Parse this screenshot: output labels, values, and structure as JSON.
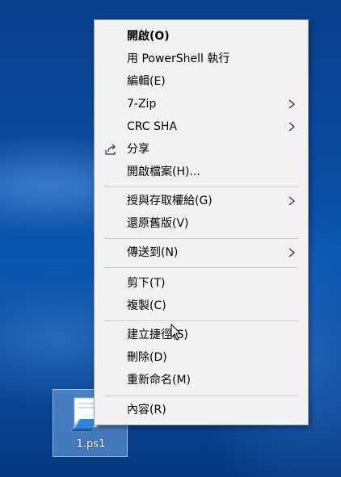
{
  "desktop": {
    "file_icon": {
      "name": "1.ps1",
      "icon": "powershell-script-file-icon"
    }
  },
  "context_menu": {
    "items": [
      {
        "label": "開啟(O)",
        "bold": true
      },
      {
        "label": "用 PowerShell 執行"
      },
      {
        "label": "編輯(E)"
      },
      {
        "label": "7-Zip",
        "submenu": true
      },
      {
        "label": "CRC SHA",
        "submenu": true
      },
      {
        "label": "分享",
        "icon": "share-icon"
      },
      {
        "label": "開啟檔案(H)..."
      },
      {
        "label": "授與存取權給(G)",
        "submenu": true
      },
      {
        "label": "還原舊版(V)"
      },
      {
        "label": "傳送到(N)",
        "submenu": true
      },
      {
        "label": "剪下(T)"
      },
      {
        "label": "複製(C)"
      },
      {
        "label": "建立捷徑(S)"
      },
      {
        "label": "刪除(D)"
      },
      {
        "label": "重新命名(M)"
      },
      {
        "label": "內容(R)"
      }
    ]
  },
  "colors": {
    "menu_bg": "#f2f2f2",
    "separator": "#c8c8c8",
    "desktop_blue": "#0b4a9c"
  }
}
